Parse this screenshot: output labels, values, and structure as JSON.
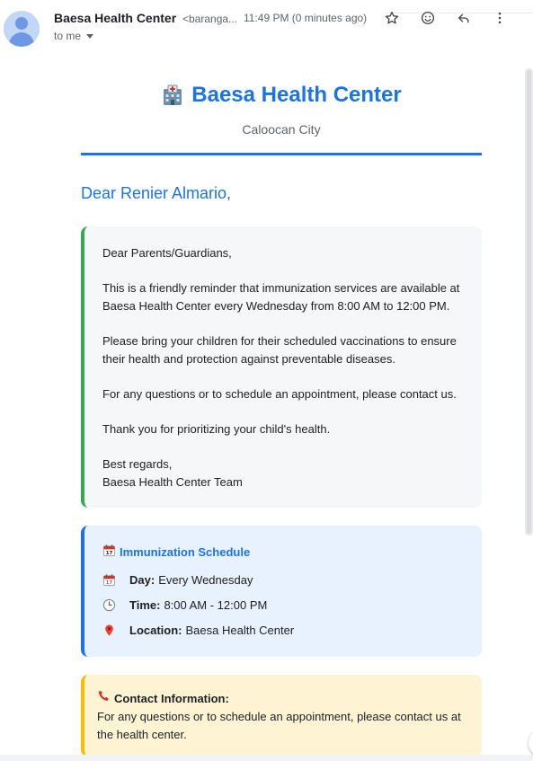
{
  "header": {
    "sender_name": "Baesa Health Center",
    "sender_email": "<baranga...",
    "time": "11:49 PM (0 minutes ago)",
    "recipient": "to me",
    "icons": [
      "star-icon",
      "emoji-icon",
      "reply-icon",
      "more-vert-icon"
    ]
  },
  "email": {
    "brand": "Baesa Health Center",
    "brand_icon": "hospital-icon",
    "city": "Caloocan City",
    "greeting": "Dear Renier Almario,",
    "message": {
      "salutation": "Dear Parents/Guardians,",
      "p1": "This is a friendly reminder that immunization services are available at Baesa Health Center every Wednesday from 8:00 AM to 12:00 PM.",
      "p2": "Please bring your children for their scheduled vaccinations to ensure their health and protection against preventable diseases.",
      "p3": "For any questions or to schedule an appointment, please contact us.",
      "p4": "Thank you for prioritizing your child's health.",
      "closing": "Best regards,",
      "signature": "Baesa Health Center Team"
    },
    "schedule": {
      "title": "Immunization Schedule",
      "day_label": "Day:",
      "day_value": "Every Wednesday",
      "time_label": "Time:",
      "time_value": "8:00 AM - 12:00 PM",
      "location_label": "Location:",
      "location_value": "Baesa Health Center"
    },
    "contact": {
      "title": "Contact Information:",
      "text": "For any questions or to schedule an appointment, please contact us at the health center."
    }
  },
  "colors": {
    "accent_blue": "#1a73e8",
    "message_border": "#34a853",
    "contact_border": "#fbbc04",
    "schedule_bg": "#e8f1fe",
    "contact_bg": "#fef4d3"
  }
}
